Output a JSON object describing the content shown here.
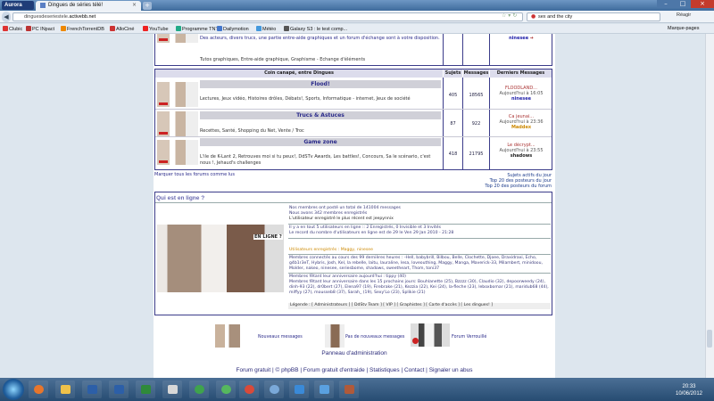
{
  "browser": {
    "app_button": "Aurora",
    "tab_title": "Dingues de séries télé!",
    "url_prefix": "dinguesdeseriestele.",
    "url_host": "activebb.net",
    "search_value": "sex and the city",
    "right_label": "Réagir",
    "bookmarks": [
      {
        "label": "Clubic",
        "color": "#d33"
      },
      {
        "label": "PC INpact",
        "color": "#b33"
      },
      {
        "label": "FrenchTorrentDB",
        "color": "#e80"
      },
      {
        "label": "AlloCiné",
        "color": "#c33"
      },
      {
        "label": "YouTube",
        "color": "#e22"
      },
      {
        "label": "Programme TNT",
        "color": "#2a8"
      },
      {
        "label": "Dailymotion",
        "color": "#47c"
      },
      {
        "label": "Météo",
        "color": "#49d"
      },
      {
        "label": "Galaxy S3 : le test comp...",
        "color": "#555"
      }
    ],
    "bookmarks_menu": "Marque-pages"
  },
  "top_section": {
    "desc": "Des acteurs, divers trucs, une partie entre-aide graphiques et un forum d'échange sont à votre disposition.",
    "subs": [
      "Tutos graphiques,",
      "Entre-aide graphique,",
      "Graphisme - Echange d'éléments"
    ],
    "last_user": "ninesee"
  },
  "table": {
    "headers": {
      "title": "Coin canapé, entre Dingues",
      "sujets": "Sujets",
      "messages": "Messages",
      "derniers": "Derniers Messages"
    },
    "forums": [
      {
        "name": "Flood!",
        "subs": "Lectures,  Jeux vidéo,  Histoires drôles,  Débats!,  Sports,  Informatique - internet,  Jeux de société",
        "topics": "405",
        "posts": "18565",
        "last_title": "FLOODLAND...",
        "last_date": "Aujourd'hui à 16:05",
        "last_user": "ninesee"
      },
      {
        "name": "Trucs & Astuces",
        "subs": "Recettes,  Santé,  Shopping du Net,  Vente / Troc",
        "topics": "87",
        "posts": "922",
        "last_title": "Ca jeunai...",
        "last_date": "Aujourd'hui à 23:36",
        "last_user": "Maddex"
      },
      {
        "name": "Game zone",
        "subs": "L'ile de K-Lant 2,  Retrouves moi si tu peux!,  DdSTv Awards,  Les battles!,  Concours,  Sa le scénario, c'est nous !,  Jehaud's challenges",
        "topics": "418",
        "posts": "21795",
        "last_title": "Le décrypt...",
        "last_date": "Aujourd'hui à 23:55",
        "last_user": "shadows"
      }
    ],
    "mark_read": "Marquer tous les forums comme lus",
    "right_links": [
      "Sujets actifs du jour",
      "Top 20 des posteurs du jour",
      "Top 20 des posteurs du forum"
    ]
  },
  "online": {
    "title": "Qui est en ligne ?",
    "poster_title": "EN LIGNE ?",
    "lines1": [
      "Nos membres ont posté un total de 141004 messages",
      "Nous avons 342 membres enregistrés",
      "L'utilisateur enregistré le plus récent est jeepynnix"
    ],
    "lines2": [
      "Il y a en tout 5 utilisateurs en ligne :: 2 Enregistrés, 0 Invisible et 3 Invités",
      "Le record du nombre d'utilisateurs en ligne est de 29 le Ven 29 Jan 2010 - 21:28"
    ],
    "registered_line": "Utilisateurs enregistrés : Maggy, ninesee",
    "last24": "Membres connectés au cours des 99 dernières heures : -Hell, babybrill, Bilbou, Belle, Clochette, Djoee, Draxidraxi, Echo, g4b1r3eT, Hybris, Josh, Kel, la rebelle, laitu, lauraline, lesa, loveouthing, Maggy, Manga, Maverick-33, Milambert, minidoou, Molder, nakeo, ninesee, seriesbome, shadows, sweetheart, Thom, toni37",
    "bday_today": "Membres fêtant leur anniversaire aujourd'hui : tippy (40)",
    "bday_soon": "Membres fêtant leur anniversaire dans les 15 prochains jours: Bouhlanette (25), Bzzzz (30), Claudio (32), depoorweedy (24), dinh-93 (22), dr0bert (27), Elena97 (19), Firebrake (21), Kezzia (22), Kei (24), la-fleche (23), leboxbomar (21), maridub68 (44), miffyy (27), mousseb8 (37), Sarah_ (19), Sexy'Lo (23), Splikie (21)",
    "legend": "Légende : [ Administrateurs ] [ DdStv Team ] [ VIP ] [ Graphistes ] [ Carte d'accès ] [ Les dingues! ]"
  },
  "icon_legend": {
    "new": "Nouveaux messages",
    "no_new": "Pas de nouveaux messages",
    "locked": "Forum Verrouillé",
    "admin": "Panneau d'administration"
  },
  "footer": {
    "items": [
      "Forum gratuit",
      "© phpBB",
      "Forum gratuit d'entraide",
      "Statistiques",
      "Contact",
      "Signaler un abus"
    ]
  },
  "taskbar": {
    "time": "20:33",
    "date": "10/06/2012",
    "apps": [
      {
        "name": "firefox",
        "color": "#e8762c"
      },
      {
        "name": "explorer",
        "color": "#f0c24a"
      },
      {
        "name": "photoshop",
        "color": "#2c5fa8"
      },
      {
        "name": "word",
        "color": "#2c5fa8"
      },
      {
        "name": "excel",
        "color": "#2f8a3a"
      },
      {
        "name": "paint",
        "color": "#d8d8d8"
      },
      {
        "name": "msn",
        "color": "#3fa34d"
      },
      {
        "name": "chrome",
        "color": "#d94a3a"
      },
      {
        "name": "itunes",
        "color": "#7aa8d8"
      },
      {
        "name": "media",
        "color": "#3a8ad8"
      },
      {
        "name": "network",
        "color": "#5aa0e0"
      },
      {
        "name": "app",
        "color": "#b05a3a"
      }
    ]
  },
  "colors": {
    "accent": "#3b3c8a",
    "link": "#2a2a8a"
  }
}
